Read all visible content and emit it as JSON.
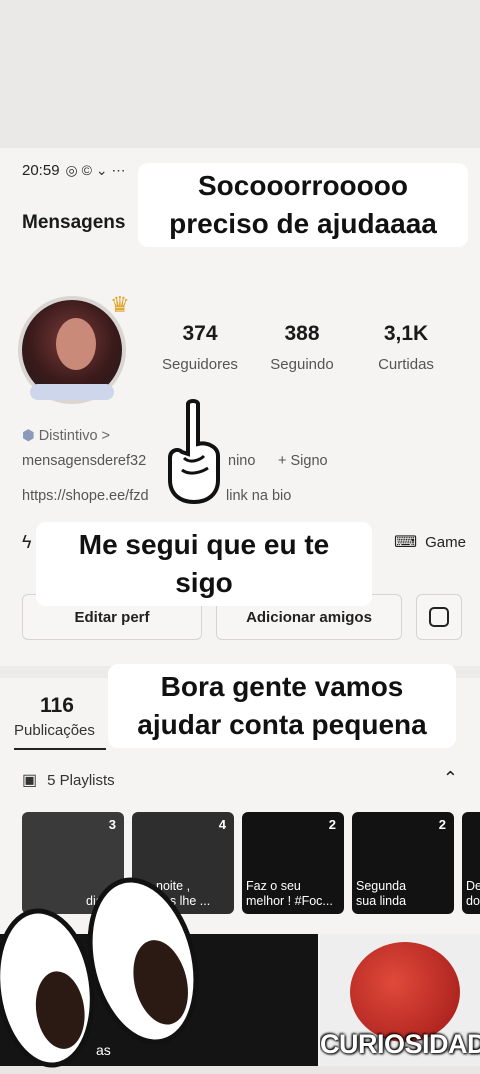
{
  "status": {
    "time": "20:59",
    "icons": "◎ © ⌄ ⋯",
    "right_icon": "◐"
  },
  "profile": {
    "username_header": "Mensagens",
    "stats": [
      {
        "value": "374",
        "label": "Seguidores"
      },
      {
        "value": "388",
        "label": "Seguindo"
      },
      {
        "value": "3,1K",
        "label": "Curtidas"
      }
    ],
    "badge_label": "Distintivo >",
    "handle": "mensagensderef32",
    "handle_suffix": "nino",
    "sign_label": "+ Signo",
    "link": "https://shope.ee/fzd",
    "link_suffix": "link na bio",
    "game_label": "Game"
  },
  "buttons": {
    "edit": "Editar perf",
    "add_friends": "Adicionar amigos"
  },
  "tabs": {
    "count": "116",
    "label": "Publicações"
  },
  "playlists": {
    "label": "5 Playlists",
    "cards": [
      {
        "count": "3",
        "title": "dia"
      },
      {
        "count": "4",
        "title": "noite ,\neus lhe ..."
      },
      {
        "count": "2",
        "title": "Faz o seu\nmelhor ! #Foc..."
      },
      {
        "count": "2",
        "title": "Segunda\nsua linda"
      },
      {
        "count": "",
        "title": "De\ndo"
      }
    ]
  },
  "bottom": {
    "left_text": "as",
    "right_text": "CURIOSIDADES"
  },
  "overlays": {
    "top": "Socooorrooooo\npreciso de ajudaaaa",
    "middle": "Me segui que eu te\nsigo",
    "bottom": "Bora gente vamos\najudar conta pequena"
  },
  "colors": {
    "crown": "#e2a42a",
    "overlay_bg": "#ffffff"
  }
}
